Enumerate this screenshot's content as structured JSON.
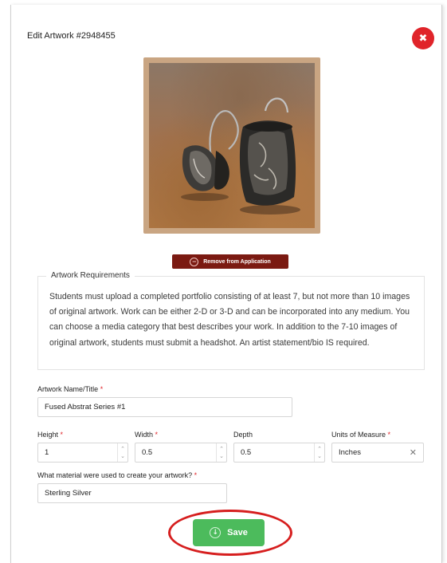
{
  "modal": {
    "title": "Edit Artwork #2948455",
    "close_icon": "close-icon",
    "close_glyph": "✖"
  },
  "artwork": {
    "image_icon": "artwork-photo",
    "frame_color": "#c9a582"
  },
  "remove_button": {
    "icon": "minus-circle-icon",
    "glyph": "−",
    "label": "Remove from Application",
    "color": "#7b1a12"
  },
  "requirements": {
    "legend": "Artwork Requirements",
    "text": "Students must upload a completed portfolio consisting of at least 7, but not more than 10 images of original artwork. Work can be either 2-D or 3-D and can be incorporated into any medium. You can choose a media category that best describes your work. In addition to the 7-10 images of original artwork, students must submit a headshot. An artist statement/bio IS required."
  },
  "form": {
    "name_label": "Artwork Name/Title",
    "name_value": "Fused Abstrat Series #1",
    "height_label": "Height",
    "height_value": "1",
    "width_label": "Width",
    "width_value": "0.5",
    "depth_label": "Depth",
    "depth_value": "0.5",
    "units_label": "Units of Measure",
    "units_value": "Inches",
    "material_label": "What material were used to create your artwork?",
    "material_value": "Sterling Silver",
    "required_marker": "*",
    "spin_up": "⌃",
    "spin_down": "⌄",
    "clear_glyph": "✕"
  },
  "save_button": {
    "label": "Save",
    "icon": "download-circle-icon",
    "glyph": "↓",
    "color": "#4cbb5c",
    "highlight_ring_color": "#d61e1e"
  }
}
